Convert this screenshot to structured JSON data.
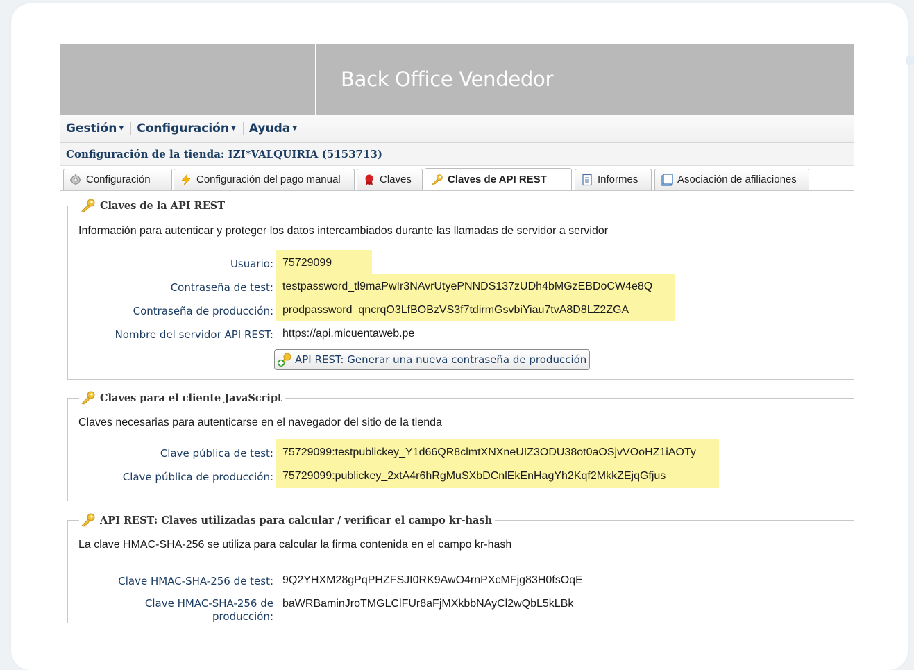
{
  "app": {
    "title": "Back Office Vendedor"
  },
  "menu": [
    {
      "label": "Gestión"
    },
    {
      "label": "Configuración"
    },
    {
      "label": "Ayuda"
    }
  ],
  "shop_line": "Configuración de la tienda: IZI*VALQUIRIA (5153713)",
  "tabs": [
    {
      "label": "Configuración",
      "icon": "gear-icon"
    },
    {
      "label": "Configuración del pago manual",
      "icon": "lightning-icon"
    },
    {
      "label": "Claves",
      "icon": "certificate-icon"
    },
    {
      "label": "Claves de API REST",
      "icon": "key-icon",
      "active": true
    },
    {
      "label": "Informes",
      "icon": "report-icon"
    },
    {
      "label": "Asociación de afiliaciones",
      "icon": "document-icon"
    }
  ],
  "rest_keys": {
    "legend": "Claves de la API REST",
    "description": "Información para autenticar y proteger los datos intercambiados durante las llamadas de servidor a servidor",
    "user_label": "Usuario:",
    "user_value": "75729099",
    "test_password_label": "Contraseña de test:",
    "test_password_value": "testpassword_tl9maPwIr3NAvrUtyePNNDS137zUDh4bMGzEBDoCW4e8Q",
    "prod_password_label": "Contraseña de producción:",
    "prod_password_value": "prodpassword_qncrqO3LfBOBzVS3f7tdirmGsvbiYiau7tvA8D8LZ2ZGA",
    "server_label": "Nombre del servidor API REST:",
    "server_value": "https://api.micuentaweb.pe",
    "generate_button": "API REST: Generar una nueva contraseña de producción"
  },
  "js_keys": {
    "legend": "Claves para el cliente JavaScript",
    "description": "Claves necesarias para autenticarse en el navegador del sitio de la tienda",
    "public_test_label": "Clave pública de test:",
    "public_test_value": "75729099:testpublickey_Y1d66QR8clmtXNXneUIZ3ODU38ot0aOSjvVOoHZ1iAOTy",
    "public_prod_label": "Clave pública de producción:",
    "public_prod_value": "75729099:publickey_2xtA4r6hRgMuSXbDCnlEkEnHagYh2Kqf2MkkZEjqGfjus"
  },
  "hash_keys": {
    "legend": "API REST: Claves utilizadas para calcular / verificar el campo kr-hash",
    "description": "La clave HMAC-SHA-256 se utiliza para calcular la firma contenida en el campo kr-hash",
    "hmac_test_label": "Clave HMAC-SHA-256 de test:",
    "hmac_test_value": "9Q2YHXM28gPqPHZFSJI0RK9AwO4rnPXcMFjg83H0fsOqE",
    "hmac_prod_label_line1": "Clave HMAC-SHA-256 de",
    "hmac_prod_label_line2": "producción:",
    "hmac_prod_value": "baWRBaminJroTMGLClFUr8aFjMXkbbNAyCl2wQbL5kLBk"
  },
  "colors": {
    "banner": "#b9b9b9",
    "highlight": "#fbf5a4",
    "menu_text": "#1c3d63"
  }
}
